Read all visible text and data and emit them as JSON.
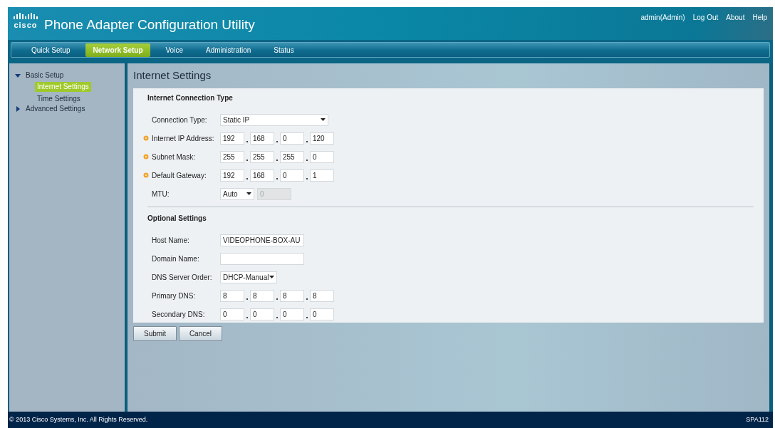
{
  "header": {
    "logo": "cisco",
    "title": "Phone Adapter Configuration Utility",
    "user_links": [
      "admin(Admin)",
      "Log Out",
      "About",
      "Help"
    ]
  },
  "tabs": [
    {
      "label": "Quick Setup",
      "selected": false
    },
    {
      "label": "Network Setup",
      "selected": true
    },
    {
      "label": "Voice",
      "selected": false
    },
    {
      "label": "Administration",
      "selected": false
    },
    {
      "label": "Status",
      "selected": false
    }
  ],
  "sidebar": {
    "items": [
      {
        "label": "Basic Setup",
        "expanded": true,
        "selected": false,
        "children": [
          {
            "label": "Internet Settings",
            "selected": true
          },
          {
            "label": "Time Settings",
            "selected": false
          }
        ]
      },
      {
        "label": "Advanced Settings",
        "expanded": false,
        "selected": false
      }
    ]
  },
  "page_title": "Internet Settings",
  "sections": [
    {
      "title": "Internet Connection Type",
      "rows": [
        {
          "kind": "select",
          "label": "Connection Type:",
          "required": false,
          "value": "Static IP",
          "wide": true
        },
        {
          "kind": "ip",
          "label": "Internet IP Address:",
          "required": true,
          "octets": [
            "192",
            "168",
            "0",
            "120"
          ]
        },
        {
          "kind": "ip",
          "label": "Subnet Mask:",
          "required": true,
          "octets": [
            "255",
            "255",
            "255",
            "0"
          ]
        },
        {
          "kind": "ip",
          "label": "Default Gateway:",
          "required": true,
          "octets": [
            "192",
            "168",
            "0",
            "1"
          ]
        },
        {
          "kind": "select_input",
          "label": "MTU:",
          "required": false,
          "value": "Auto",
          "input": "0",
          "disabled": true
        }
      ]
    },
    {
      "title": "Optional Settings",
      "rows": [
        {
          "kind": "text",
          "label": "Host Name:",
          "required": false,
          "value": "VIDEOPHONE-BOX-AU"
        },
        {
          "kind": "text",
          "label": "Domain Name:",
          "required": false
        },
        {
          "kind": "select",
          "label": "DNS Server Order:",
          "required": false,
          "value": "DHCP-Manual",
          "wide": false
        },
        {
          "kind": "ip",
          "label": "Primary DNS:",
          "required": false,
          "octets": [
            "8",
            "8",
            "8",
            "8"
          ]
        },
        {
          "kind": "ip",
          "label": "Secondary DNS:",
          "required": false,
          "octets": [
            "0",
            "0",
            "0",
            "0"
          ]
        }
      ]
    }
  ],
  "buttons": [
    "Submit",
    "Cancel"
  ],
  "footer": {
    "copyright": "© 2013 Cisco Systems, Inc. All Rights Reserved.",
    "model": "SPA112"
  }
}
